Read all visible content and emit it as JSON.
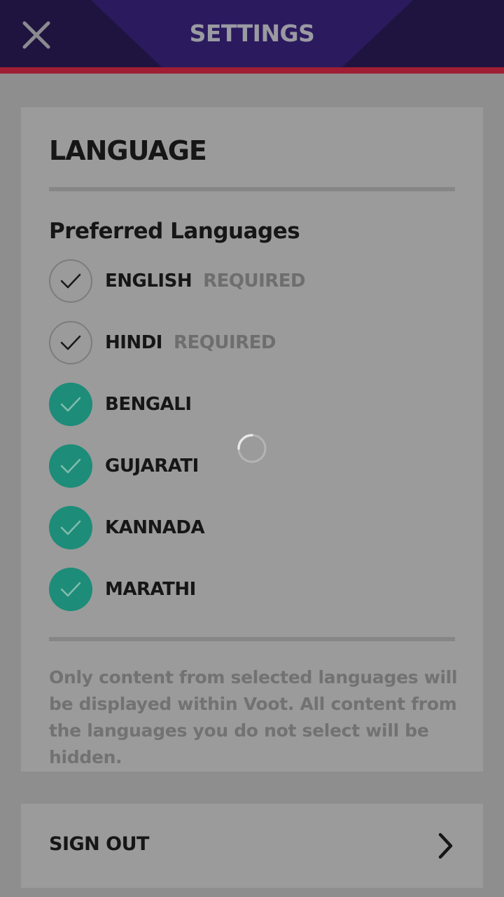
{
  "header": {
    "title": "SETTINGS",
    "close_icon": "close-icon"
  },
  "language_section": {
    "title": "LANGUAGE",
    "subtitle": "Preferred Languages",
    "languages": [
      {
        "label": "ENGLISH",
        "required_label": "REQUIRED",
        "checked": true,
        "required": true
      },
      {
        "label": "HINDI",
        "required_label": "REQUIRED",
        "checked": true,
        "required": true
      },
      {
        "label": "BENGALI",
        "checked": true,
        "required": false
      },
      {
        "label": "GUJARATI",
        "checked": true,
        "required": false
      },
      {
        "label": "KANNADA",
        "checked": true,
        "required": false
      },
      {
        "label": "MARATHI",
        "checked": true,
        "required": false
      }
    ],
    "note": "Only content from selected languages will be displayed within Voot. All content from the languages you do not select will be hidden."
  },
  "signout": {
    "label": "SIGN OUT",
    "icon": "chevron-right-icon"
  },
  "colors": {
    "header_bg": "#1f1440",
    "header_accent": "#a01e34",
    "checked_bg": "#1d8c78"
  },
  "loading_icon": "spinner-icon"
}
